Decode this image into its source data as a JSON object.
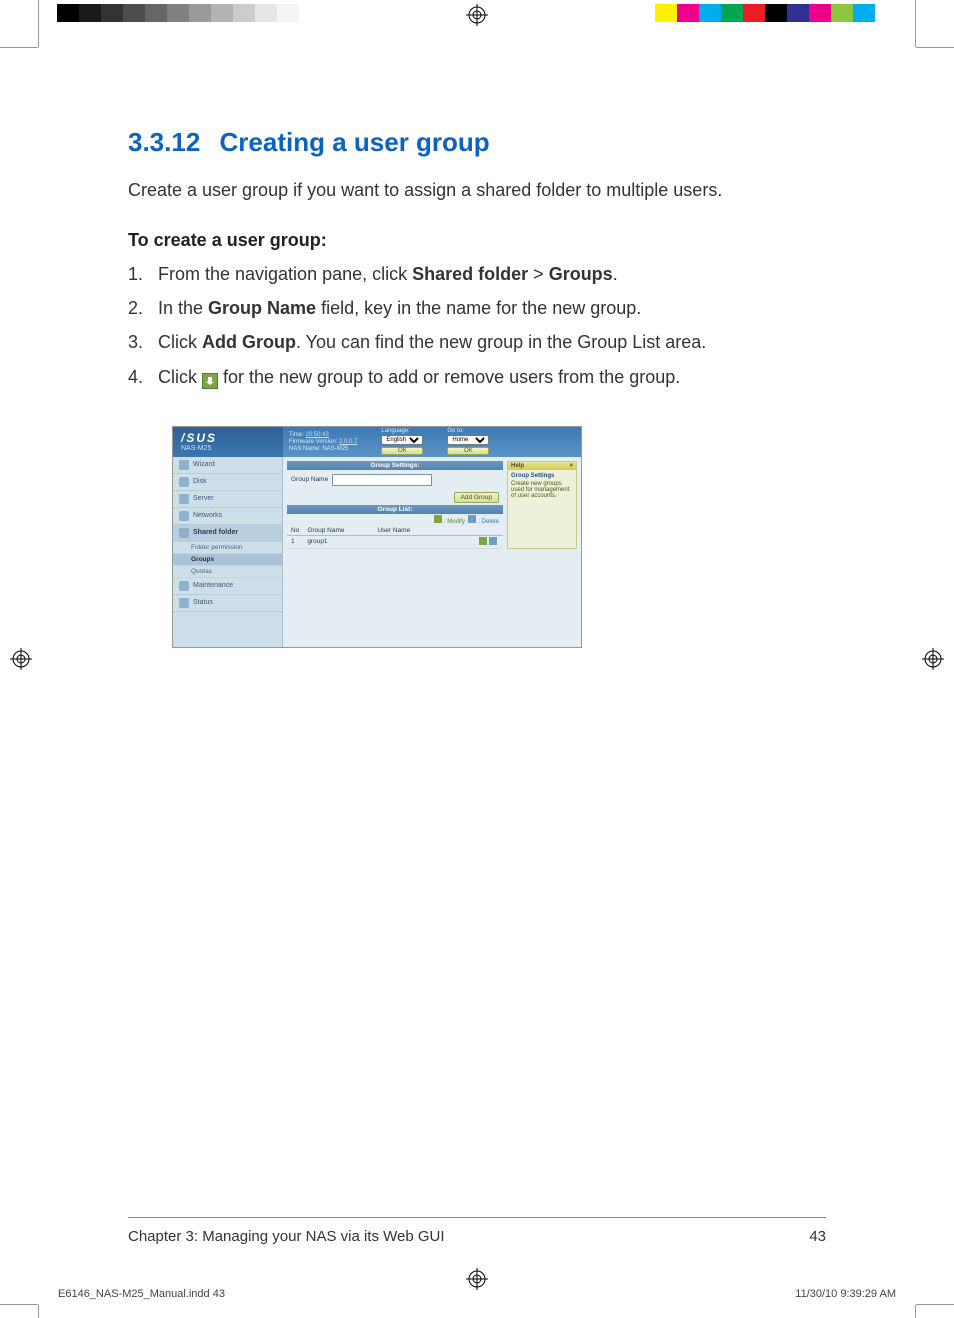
{
  "print": {
    "left_swatches": [
      "#000000",
      "#1a1a1a",
      "#333333",
      "#4d4d4d",
      "#666666",
      "#808080",
      "#999999",
      "#b3b3b3",
      "#cccccc",
      "#e6e6e6",
      "#f5f5f5",
      "#ffffff"
    ],
    "right_swatches": [
      "#ffffff",
      "#fff200",
      "#ec008c",
      "#00aeef",
      "#00a651",
      "#ed1c24",
      "#000000",
      "#2e3192",
      "#ec008c",
      "#8dc63f",
      "#00aeef",
      "#ffffff"
    ]
  },
  "heading": {
    "number": "3.3.12",
    "title": "Creating a user group"
  },
  "intro": "Create a user group if you want to assign a shared folder to multiple users.",
  "procedure_title": "To create a user group:",
  "steps": {
    "s1_a": "From the navigation pane, click ",
    "s1_b": "Shared folder",
    "s1_c": " > ",
    "s1_d": "Groups",
    "s1_e": ".",
    "s2_a": "In the ",
    "s2_b": "Group Name",
    "s2_c": " field, key in the name for the new group.",
    "s3_a": "Click ",
    "s3_b": "Add Group",
    "s3_c": ". You can find the new group in the Group List area.",
    "s4_a": "Click ",
    "s4_b": " for the new group to add or remove users from the group."
  },
  "screenshot": {
    "brand_logo": "/SUS",
    "brand_sub": "NAS-M25",
    "top": {
      "time_label": "Time:",
      "time_value": "20:50:43",
      "fw_label": "Firmware Version:",
      "fw_value": "2.0.0.7",
      "nasname_label": "NAS Name:",
      "nasname_value": "NAS-M25",
      "lang_label": "Language:",
      "lang_value": "English",
      "goto_label": "Go to:",
      "goto_value": "Home",
      "ok": "OK"
    },
    "nav": {
      "wizard": "Wizard",
      "disk": "Disk",
      "server": "Server",
      "networks": "Networks",
      "shared": "Shared folder",
      "sub_folderperm": "Folder permission",
      "sub_groups": "Groups",
      "sub_quotas": "Quotas",
      "maint": "Maintenance",
      "status": "Status"
    },
    "main": {
      "group_settings": "Group Settings:",
      "group_name_label": "Group Name",
      "add_group": "Add Group",
      "group_list": "Group List:",
      "legend_modify": ": Modify",
      "legend_delete": ": Delete",
      "th_no": "No",
      "th_group": "Group Name",
      "th_user": "User Name",
      "row1_no": "1",
      "row1_group": "group1"
    },
    "help": {
      "title": "Help",
      "collapse": "×",
      "h": "Group Settings",
      "body": "Create new groups used for management of user accounts."
    }
  },
  "footer": {
    "chapter": "Chapter 3: Managing your NAS via its Web GUI",
    "page": "43"
  },
  "indd": {
    "file": "E6146_NAS-M25_Manual.indd   43",
    "stamp": "11/30/10   9:39:29 AM"
  }
}
